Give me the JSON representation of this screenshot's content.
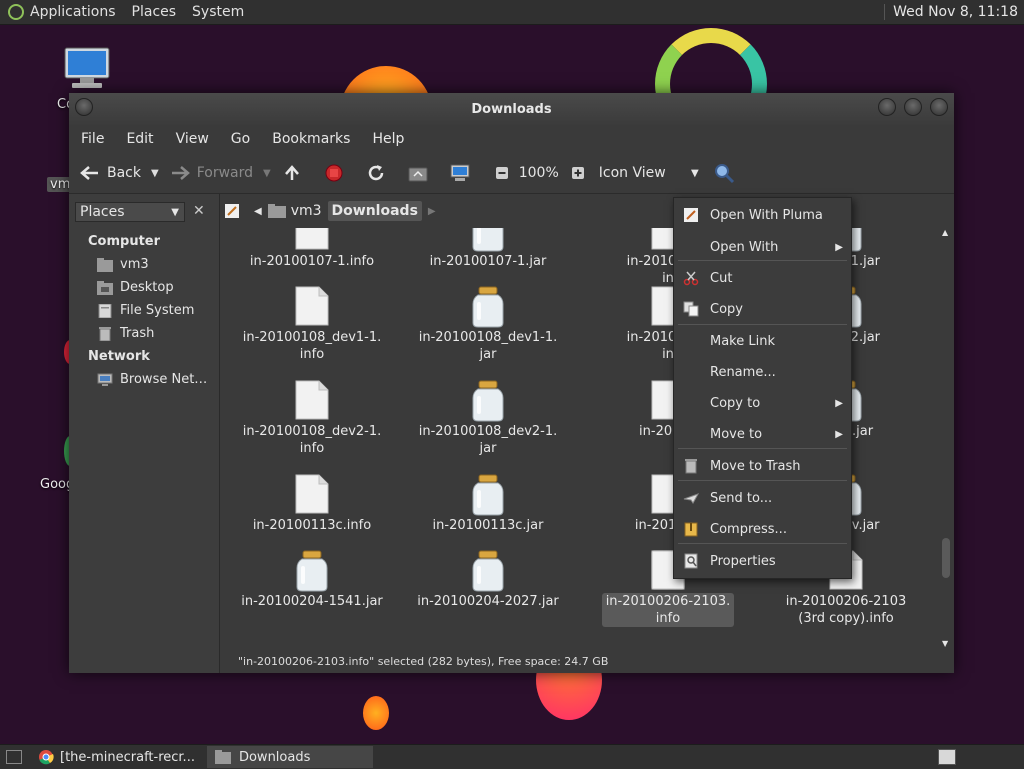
{
  "top_panel": {
    "menus": [
      "Applications",
      "Places",
      "System"
    ],
    "clock": "Wed Nov 8, 11:18"
  },
  "desktop": {
    "icon_labels": [
      "Co",
      "vm",
      "Goog"
    ]
  },
  "window": {
    "title": "Downloads",
    "menubar": [
      "File",
      "Edit",
      "View",
      "Go",
      "Bookmarks",
      "Help"
    ],
    "toolbar": {
      "back": "Back",
      "forward": "Forward",
      "zoom": "100%",
      "view_mode": "Icon View"
    },
    "sidebar": {
      "places_label": "Places",
      "computer_heading": "Computer",
      "computer_items": [
        "vm3",
        "Desktop",
        "File System",
        "Trash"
      ],
      "network_heading": "Network",
      "network_items": [
        "Browse Net…"
      ]
    },
    "path": [
      "vm3",
      "Downloads"
    ],
    "files": [
      {
        "line1": "in-20100107-1.info",
        "line2": "",
        "kind": "doc",
        "partial": true
      },
      {
        "line1": "in-20100107-1.jar",
        "line2": "",
        "kind": "jar",
        "partial": true
      },
      {
        "line1": "in-20100107",
        "line2": "in",
        "kind": "doc",
        "partial": true
      },
      {
        "line1": "8_dev1.jar",
        "line2": "",
        "kind": "jar",
        "partial": true
      },
      {
        "line1": "in-20100108_dev1-1.",
        "line2": "info",
        "kind": "doc"
      },
      {
        "line1": "in-20100108_dev1-1.",
        "line2": "jar",
        "kind": "jar"
      },
      {
        "line1": "in-20100108",
        "line2": "in",
        "kind": "doc"
      },
      {
        "line1": "8_dev2.jar",
        "line2": "",
        "kind": "jar"
      },
      {
        "line1": "in-20100108_dev2-1.",
        "line2": "info",
        "kind": "doc"
      },
      {
        "line1": "in-20100108_dev2-1.",
        "line2": "jar",
        "kind": "jar"
      },
      {
        "line1": "in-20100",
        "line2": "",
        "kind": "doc"
      },
      {
        "line1": "0113.jar",
        "line2": "",
        "kind": "jar"
      },
      {
        "line1": "in-20100113c.info",
        "line2": "",
        "kind": "doc"
      },
      {
        "line1": "in-20100113c.jar",
        "line2": "",
        "kind": "jar"
      },
      {
        "line1": "in-201002",
        "line2": "",
        "kind": "doc"
      },
      {
        "line1": "02_dev.jar",
        "line2": "",
        "kind": "jar"
      },
      {
        "line1": "in-20100204-1541.jar",
        "line2": "",
        "kind": "jar"
      },
      {
        "line1": "in-20100204-2027.jar",
        "line2": "",
        "kind": "jar"
      },
      {
        "line1": "in-20100206-2103.",
        "line2": "info",
        "kind": "doc",
        "selected": true
      },
      {
        "line1": "in-20100206-2103",
        "line2": "(3rd copy).info",
        "kind": "doc"
      }
    ],
    "status": "\"in-20100206-2103.info\" selected (282 bytes), Free space: 24.7 GB"
  },
  "context_menu": {
    "items": [
      {
        "label": "Open With Pluma",
        "icon": "pluma-icon"
      },
      {
        "label": "Open With",
        "submenu": true
      },
      {
        "label": "Cut",
        "icon": "scissors-icon"
      },
      {
        "label": "Copy",
        "icon": "copy-icon"
      },
      {
        "label": "Make Link"
      },
      {
        "label": "Rename..."
      },
      {
        "label": "Copy to",
        "submenu": true
      },
      {
        "label": "Move to",
        "submenu": true
      },
      {
        "label": "Move to Trash",
        "icon": "trash-icon"
      },
      {
        "label": "Send to...",
        "icon": "send-icon"
      },
      {
        "label": "Compress...",
        "icon": "archive-icon"
      },
      {
        "label": "Properties",
        "icon": "properties-icon"
      }
    ]
  },
  "taskbar": {
    "tasks": [
      "[the-minecraft-recr...",
      "Downloads"
    ]
  }
}
